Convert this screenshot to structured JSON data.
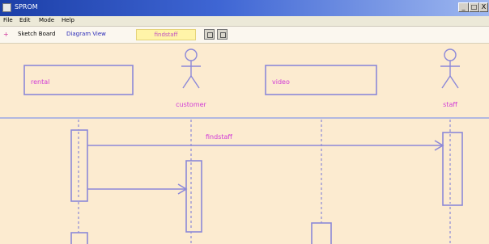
{
  "window": {
    "title": "SPROM",
    "min_glyph": "_",
    "max_glyph": "□",
    "close_glyph": "X"
  },
  "menu": [
    "File",
    "Edit",
    "Mode",
    "Help"
  ],
  "toolbar": {
    "mark": "+",
    "sketch_label": "Sketch Board",
    "diagram_view_label": "Diagram View",
    "message": "findstaff"
  },
  "diagram": {
    "objects": [
      {
        "type": "box",
        "label": "rental"
      },
      {
        "type": "actor",
        "label": "customer"
      },
      {
        "type": "box",
        "label": "video"
      },
      {
        "type": "actor",
        "label": "staff"
      }
    ],
    "messages": [
      {
        "label": "findstaff"
      },
      {
        "label": ""
      }
    ],
    "colors": {
      "line": "#8c88d8",
      "label": "#d13ad6",
      "separator": "#9aa6e6"
    }
  }
}
